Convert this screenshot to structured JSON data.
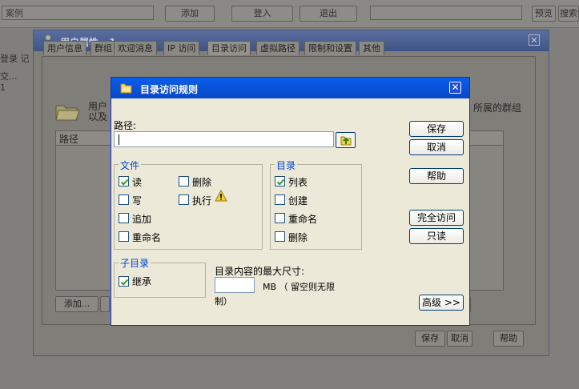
{
  "background_app": {
    "toolbar": {
      "field1": "案例",
      "add_label": "添加",
      "login_label": "登入",
      "logout_label": "退出",
      "prefix_label": "预览",
      "search_label": "搜索"
    },
    "sidebar_labels": [
      "登录 记",
      "交...",
      "1"
    ]
  },
  "user_window": {
    "title": "用户属性 - 1",
    "tabs": [
      "用户信息",
      "群组",
      "欢迎消息",
      "IP 访问",
      "目录访问",
      "虚拟路径",
      "限制和设置",
      "其他"
    ],
    "description_left": "用户",
    "description_left_2": "以及",
    "description_right": "所属的群组",
    "list_header": "路径",
    "add_button": "添加...",
    "save_button": "保存",
    "cancel_button": "取消",
    "help_button": "帮助"
  },
  "dialog": {
    "title": "目录访问规则",
    "path_label": "路径:",
    "path_value": "",
    "files": {
      "legend": "文件",
      "items": [
        {
          "label": "读",
          "checked": true
        },
        {
          "label": "写",
          "checked": false
        },
        {
          "label": "追加",
          "checked": false
        },
        {
          "label": "重命名",
          "checked": false
        },
        {
          "label": "删除",
          "checked": false
        },
        {
          "label": "执行",
          "checked": false
        }
      ]
    },
    "directories": {
      "legend": "目录",
      "items": [
        {
          "label": "列表",
          "checked": true
        },
        {
          "label": "创建",
          "checked": false
        },
        {
          "label": "重命名",
          "checked": false
        },
        {
          "label": "删除",
          "checked": false
        }
      ]
    },
    "subdirectories": {
      "legend": "子目录",
      "items": [
        {
          "label": "继承",
          "checked": true
        }
      ]
    },
    "max_size_label": "目录内容的最大尺寸:",
    "max_size_value": "",
    "max_size_unit_line1": "MB （ 留空则无限",
    "max_size_unit_line2": "制）",
    "buttons": {
      "save": "保存",
      "cancel": "取消",
      "help": "帮助",
      "full_access": "完全访问",
      "read_only": "只读",
      "advanced": "高级 >>"
    },
    "warning_icon": "warning-icon"
  }
}
